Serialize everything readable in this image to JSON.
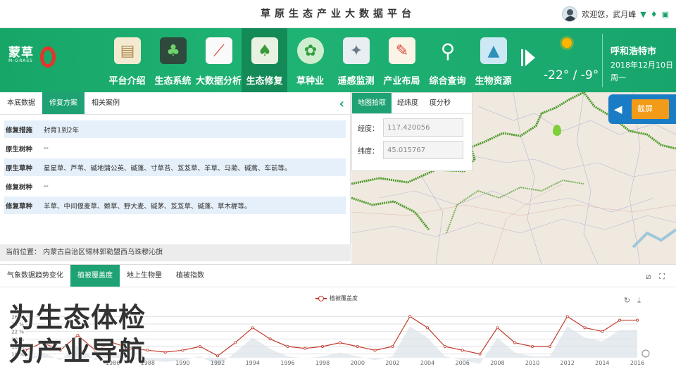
{
  "header": {
    "title": "草原生态产业大数据平台",
    "welcome": "欢迎您，武月峰",
    "icons": [
      "filter-icon",
      "shirt-icon",
      "device-icon"
    ]
  },
  "logo": {
    "cn": "蒙草",
    "en": "M-GRASS"
  },
  "nav": {
    "items": [
      {
        "label": "平台介绍",
        "icon": "scroll-icon"
      },
      {
        "label": "生态系统",
        "icon": "forest-icon"
      },
      {
        "label": "大数据分析",
        "icon": "line-chart-icon"
      },
      {
        "label": "生态修复",
        "icon": "tree-icon"
      },
      {
        "label": "草种业",
        "icon": "grass-dome-icon"
      },
      {
        "label": "遥感监测",
        "icon": "satellite-icon"
      },
      {
        "label": "产业布局",
        "icon": "certificate-icon"
      },
      {
        "label": "综合查询",
        "icon": "magnifier-icon"
      },
      {
        "label": "生物资源",
        "icon": "picture-icon"
      }
    ],
    "active_index": 3
  },
  "weather": {
    "temperature": "-22° / -9°",
    "city": "呼和浩特市",
    "date": "2018年12月10日",
    "weekday": "周一"
  },
  "left_panel": {
    "tabs": [
      "本底数据",
      "修复方案",
      "相关案例"
    ],
    "active_tab": 1,
    "rows": [
      {
        "key": "修复措施",
        "value": "封育1到2年"
      },
      {
        "key": "原生树种",
        "value": "--"
      },
      {
        "key": "原生草种",
        "value": "星星草、芦苇、碱地蒲公英、碱蓬、寸草苔、芨芨草、羊草、马蔺、碱蒿、车前等。"
      },
      {
        "key": "修复树种",
        "value": "--"
      },
      {
        "key": "修复草种",
        "value": "羊草、中间偃麦草、赖草、野大麦、碱茅、芨芨草、碱蓬、草木樨等。"
      }
    ],
    "location": "当前位置： 内蒙古自治区锡林郭勒盟西乌珠穆沁旗"
  },
  "map_panel": {
    "tabs": [
      "地图拾取",
      "经纬度",
      "度分秒"
    ],
    "active_tab": 0,
    "lon_label": "经度：",
    "lon_value": "117.420056",
    "lat_label": "纬度：",
    "lat_value": "45.015767",
    "screenshot_label": "截屏"
  },
  "bottom_panel": {
    "tabs": [
      "气象数据趋势变化",
      "植被覆盖度",
      "地上生物量",
      "植被指数"
    ],
    "active_tab": 1
  },
  "chart_data": {
    "type": "line",
    "series": [
      {
        "name": "植被覆盖度",
        "color": "#c0392b",
        "values": [
          17,
          19,
          17,
          21,
          17,
          19,
          17.5,
          17,
          16.5,
          17,
          18,
          15.5,
          19,
          23,
          20,
          18,
          17.5,
          18,
          19,
          18,
          17,
          18,
          26,
          23,
          18,
          17,
          16,
          23,
          19,
          18,
          18,
          26,
          23,
          22,
          25,
          25
        ]
      }
    ],
    "x": [
      1981,
      1982,
      1983,
      1984,
      1985,
      1986,
      1987,
      1988,
      1989,
      1990,
      1991,
      1992,
      1993,
      1994,
      1995,
      1996,
      1997,
      1998,
      1999,
      2000,
      2001,
      2002,
      2003,
      2004,
      2005,
      2006,
      2007,
      2008,
      2009,
      2010,
      2011,
      2012,
      2013,
      2014,
      2015,
      2016
    ],
    "x_tick_labels": [
      "1986",
      "1988",
      "1990",
      "1992",
      "1994",
      "1996",
      "1998",
      "2000",
      "2002",
      "2004",
      "2006",
      "2008",
      "2010",
      "2012",
      "2014",
      "2016"
    ],
    "y_tick_labels": [
      "16 %",
      "18 %",
      "20 %",
      "22 %",
      "24 %",
      "26 %"
    ],
    "ylim": [
      15,
      27
    ]
  },
  "slogan": {
    "line1": "为生态体检",
    "line2": "为产业导航"
  }
}
